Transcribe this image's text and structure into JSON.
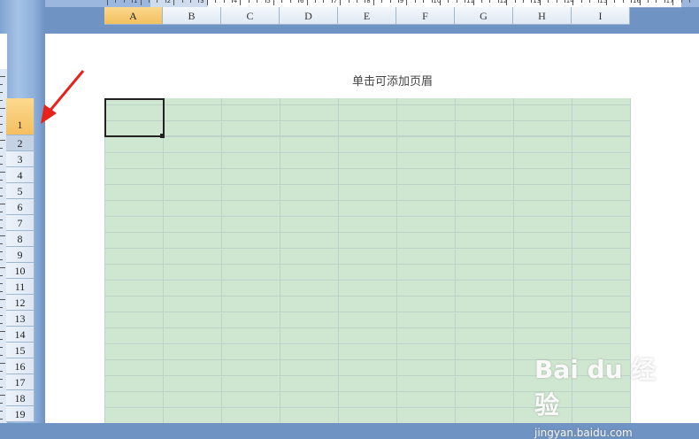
{
  "page": {
    "header_hint": "单击可添加页眉"
  },
  "ruler": {
    "numbers": [
      "1",
      "2",
      "3",
      "4",
      "5",
      "6",
      "7",
      "8",
      "9",
      "10",
      "11",
      "12",
      "13",
      "14",
      "15",
      "16",
      "17"
    ]
  },
  "columns": [
    "A",
    "B",
    "C",
    "D",
    "E",
    "F",
    "G",
    "H",
    "I"
  ],
  "active_column": "A",
  "rows": [
    "1",
    "2",
    "3",
    "4",
    "5",
    "6",
    "7",
    "8",
    "9",
    "10",
    "11",
    "12",
    "13",
    "14",
    "15",
    "16",
    "17",
    "18",
    "19"
  ],
  "active_row": "1",
  "colors": {
    "grid_fill": "#cfe6d0",
    "header_active": "#f4bf5f",
    "arrow": "#e8221b"
  },
  "watermark": {
    "logo": "Bai du 经验",
    "site": "jingyan.baidu.com"
  }
}
